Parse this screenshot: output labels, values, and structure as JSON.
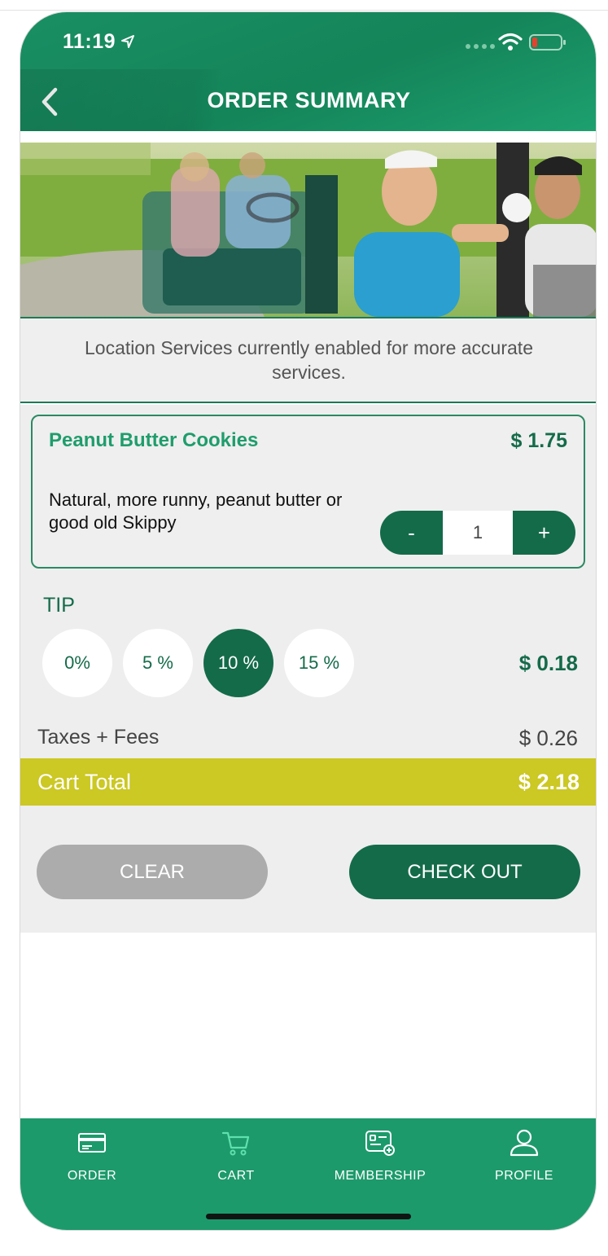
{
  "status_bar": {
    "time": "11:19"
  },
  "header": {
    "title": "ORDER SUMMARY"
  },
  "location_message": "Location Services currently enabled for more accurate services.",
  "cart_item": {
    "name": "Peanut Butter Cookies",
    "price": "$ 1.75",
    "description": "Natural, more runny, peanut butter or good old Skippy",
    "quantity": "1",
    "decrement_label": "-",
    "increment_label": "+"
  },
  "tip": {
    "label": "TIP",
    "options": [
      "0%",
      "5 %",
      "10 %",
      "15 %"
    ],
    "selected": "10 %",
    "amount": "$ 0.18"
  },
  "taxes": {
    "label": "Taxes + Fees",
    "amount": "$ 0.26"
  },
  "total": {
    "label": "Cart Total",
    "amount": "$ 2.18"
  },
  "actions": {
    "clear_label": "CLEAR",
    "checkout_label": "CHECK OUT"
  },
  "tabbar": {
    "items": [
      {
        "label": "ORDER",
        "icon": "order-card-icon"
      },
      {
        "label": "CART",
        "icon": "cart-icon"
      },
      {
        "label": "MEMBERSHIP",
        "icon": "membership-card-icon"
      },
      {
        "label": "PROFILE",
        "icon": "profile-icon"
      }
    ]
  },
  "colors": {
    "brand_green": "#1d9a6c",
    "dark_green": "#146b4a",
    "total_bar": "#ccc824",
    "clear_button": "#acacac"
  }
}
